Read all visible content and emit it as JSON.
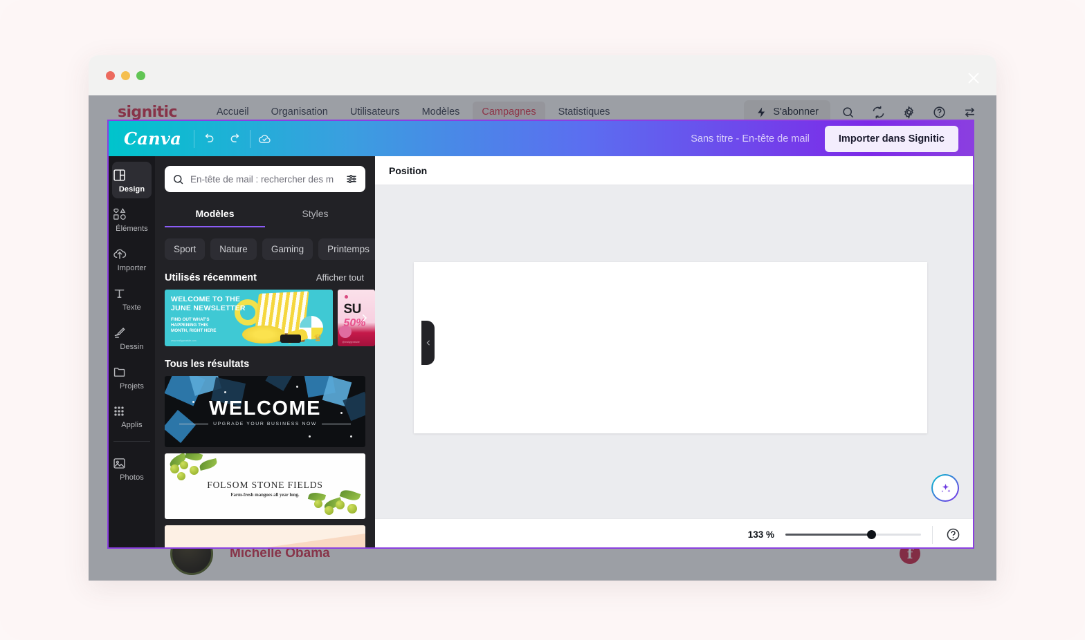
{
  "window": {
    "traffic_lights": [
      "close",
      "minimize",
      "maximize"
    ]
  },
  "signitic_nav": {
    "logo": "signitic",
    "links": [
      {
        "label": "Accueil",
        "active": false
      },
      {
        "label": "Organisation",
        "active": false
      },
      {
        "label": "Utilisateurs",
        "active": false
      },
      {
        "label": "Modèles",
        "active": false
      },
      {
        "label": "Campagnes",
        "active": true
      },
      {
        "label": "Statistiques",
        "active": false
      }
    ],
    "subscribe_label": "S'abonner",
    "icons": [
      "search-icon",
      "sync-icon",
      "gear-icon",
      "help-icon",
      "switch-icon"
    ]
  },
  "background_page": {
    "contact_name": "Michelle Obama",
    "social_icon": "facebook-icon"
  },
  "overlay": {
    "close_icon": "close-icon"
  },
  "canva": {
    "logo": "Canva",
    "toolbar_icons": [
      "undo-icon",
      "redo-icon",
      "cloud-saved-icon"
    ],
    "document_title": "Sans titre - En-tête de mail",
    "import_button": "Importer dans Signitic",
    "accent_color": "#8b3fe0"
  },
  "rail": {
    "items": [
      {
        "label": "Design",
        "icon": "design-icon",
        "active": true
      },
      {
        "label": "Éléments",
        "icon": "elements-icon",
        "active": false
      },
      {
        "label": "Importer",
        "icon": "upload-icon",
        "active": false
      },
      {
        "label": "Texte",
        "icon": "text-icon",
        "active": false
      },
      {
        "label": "Dessin",
        "icon": "draw-icon",
        "active": false
      },
      {
        "label": "Projets",
        "icon": "folder-icon",
        "active": false
      },
      {
        "label": "Applis",
        "icon": "apps-grid-icon",
        "active": false
      },
      {
        "label": "Photos",
        "icon": "photos-icon",
        "active": false
      }
    ]
  },
  "panel": {
    "search": {
      "placeholder": "En-tête de mail : rechercher des m",
      "value": "",
      "search_icon": "search-icon",
      "filter_icon": "sliders-icon"
    },
    "tabs": [
      {
        "label": "Modèles",
        "active": true
      },
      {
        "label": "Styles",
        "active": false
      }
    ],
    "chips": [
      "Sport",
      "Nature",
      "Gaming",
      "Printemps"
    ],
    "chips_next_icon": "chevron-right-icon",
    "recent": {
      "title": "Utilisés récemment",
      "see_all": "Afficher tout",
      "next_icon": "chevron-right-icon",
      "items": [
        {
          "name": "june-newsletter-template",
          "line1": "WELCOME TO THE",
          "line2": "JUNE NEWSLETTER",
          "line3": "FIND OUT WHAT'S\nHAPPENING THIS\nMONTH, RIGHT HERE",
          "footer": "www.reallygreatsite.com"
        },
        {
          "name": "summer-sale-template",
          "line1": "SU",
          "line2": "50%",
          "footer": "@reallygreatsite"
        }
      ]
    },
    "results": {
      "title": "Tous les résultats",
      "items": [
        {
          "name": "welcome-business-template",
          "title": "WELCOME",
          "subtitle": "UPGRADE YOUR BUSINESS NOW"
        },
        {
          "name": "folsom-stone-fields-template",
          "title": "FOLSOM STONE FIELDS",
          "subtitle": "Farm-fresh mangoes all year long."
        },
        {
          "name": "peach-banner-template",
          "title": "",
          "subtitle": ""
        }
      ]
    },
    "collapse_icon": "chevron-left-icon"
  },
  "canvas": {
    "position_label": "Position",
    "magic_icon": "magic-sparkle-icon",
    "zoom_value": "133 %",
    "help_icon": "help-circle-icon"
  }
}
